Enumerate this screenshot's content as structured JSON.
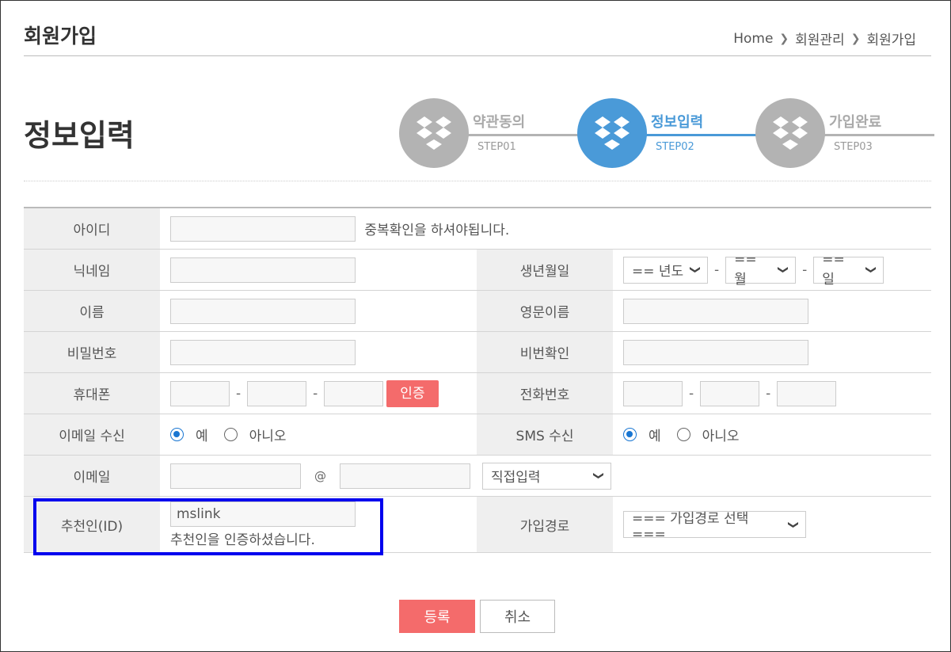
{
  "header": {
    "page_title": "회원가입",
    "breadcrumb": [
      "Home",
      "회원관리",
      "회원가입"
    ]
  },
  "section_title": "정보입력",
  "steps": [
    {
      "label": "약관동의",
      "sub": "STEP01",
      "active": false
    },
    {
      "label": "정보입력",
      "sub": "STEP02",
      "active": true
    },
    {
      "label": "가입완료",
      "sub": "STEP03",
      "active": false
    }
  ],
  "form": {
    "id_label": "아이디",
    "id_value": "",
    "id_hint": "중복확인을 하셔야됩니다.",
    "nickname_label": "닉네임",
    "birth_label": "생년월일",
    "birth_year": "== 년도",
    "birth_month": "== 월",
    "birth_day": "== 일",
    "name_label": "이름",
    "eng_name_label": "영문이름",
    "password_label": "비밀번호",
    "password_confirm_label": "비번확인",
    "mobile_label": "휴대폰",
    "verify_button": "인증",
    "phone_label": "전화번호",
    "email_recv_label": "이메일 수신",
    "sms_recv_label": "SMS 수신",
    "yes": "예",
    "no": "아니오",
    "email_label": "이메일",
    "at": "@",
    "email_domain_select": "직접입력",
    "referrer_label": "추천인(ID)",
    "referrer_value": "mslink",
    "referrer_hint": "추천인을 인증하셨습니다.",
    "join_route_label": "가입경로",
    "join_route_select": "=== 가입경로 선택 ==="
  },
  "buttons": {
    "submit": "등록",
    "cancel": "취소"
  },
  "colors": {
    "accent_blue": "#4a9ad8",
    "button_red": "#f46b6b",
    "highlight_box": "#0000ee"
  }
}
